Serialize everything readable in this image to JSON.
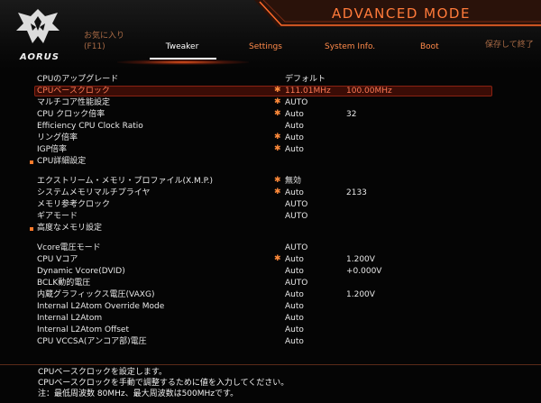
{
  "header": {
    "logo_text": "AORUS",
    "mode_title": "ADVANCED MODE"
  },
  "nav": {
    "favorites_label": "お気に入り",
    "favorites_key": "(F11)",
    "tweaker": "Tweaker",
    "settings": "Settings",
    "system_info": "System Info.",
    "boot": "Boot",
    "save_exit": "保存して終了"
  },
  "rows": [
    {
      "label": "CPUのアップグレード",
      "value": "デフォルト",
      "extra": "",
      "star": false,
      "selected": false,
      "bullet": false
    },
    {
      "label": "CPUベースクロック",
      "value": "111.01MHz",
      "extra": "100.00MHz",
      "star": true,
      "selected": true,
      "bullet": false
    },
    {
      "label": "マルチコア性能設定",
      "value": "AUTO",
      "extra": "",
      "star": true,
      "selected": false,
      "bullet": false
    },
    {
      "label": "CPU クロック倍率",
      "value": "Auto",
      "extra": "32",
      "star": true,
      "selected": false,
      "bullet": false
    },
    {
      "label": "Efficiency CPU Clock Ratio",
      "value": "Auto",
      "extra": "",
      "star": false,
      "selected": false,
      "bullet": false
    },
    {
      "label": "リング倍率",
      "value": "Auto",
      "extra": "",
      "star": true,
      "selected": false,
      "bullet": false
    },
    {
      "label": "IGP倍率",
      "value": "Auto",
      "extra": "",
      "star": true,
      "selected": false,
      "bullet": false
    },
    {
      "label": "CPU詳細設定",
      "value": "",
      "extra": "",
      "star": false,
      "selected": false,
      "bullet": true
    },
    {
      "label": "エクストリーム・メモリ・プロファイル(X.M.P.)",
      "value": "無効",
      "extra": "",
      "star": true,
      "selected": false,
      "bullet": false
    },
    {
      "label": "システムメモリマルチプライヤ",
      "value": "Auto",
      "extra": "2133",
      "star": true,
      "selected": false,
      "bullet": false
    },
    {
      "label": "メモリ参考クロック",
      "value": "AUTO",
      "extra": "",
      "star": false,
      "selected": false,
      "bullet": false
    },
    {
      "label": "ギアモード",
      "value": "AUTO",
      "extra": "",
      "star": false,
      "selected": false,
      "bullet": false
    },
    {
      "label": "高度なメモリ設定",
      "value": "",
      "extra": "",
      "star": false,
      "selected": false,
      "bullet": true
    },
    {
      "label": "Vcore電圧モード",
      "value": "AUTO",
      "extra": "",
      "star": false,
      "selected": false,
      "bullet": false
    },
    {
      "label": "CPU Vコア",
      "value": "Auto",
      "extra": "1.200V",
      "star": true,
      "selected": false,
      "bullet": false
    },
    {
      "label": "Dynamic Vcore(DVID)",
      "value": "Auto",
      "extra": "+0.000V",
      "star": false,
      "selected": false,
      "bullet": false
    },
    {
      "label": "BCLK動的電圧",
      "value": "AUTO",
      "extra": "",
      "star": false,
      "selected": false,
      "bullet": false
    },
    {
      "label": "内蔵グラフィックス電圧(VAXG)",
      "value": "Auto",
      "extra": "1.200V",
      "star": false,
      "selected": false,
      "bullet": false
    },
    {
      "label": "Internal L2Atom Override Mode",
      "value": "Auto",
      "extra": "",
      "star": false,
      "selected": false,
      "bullet": false
    },
    {
      "label": "Internal L2Atom",
      "value": "Auto",
      "extra": "",
      "star": false,
      "selected": false,
      "bullet": false
    },
    {
      "label": "Internal L2Atom Offset",
      "value": "Auto",
      "extra": "",
      "star": false,
      "selected": false,
      "bullet": false
    },
    {
      "label": "CPU VCCSA(アンコア部)電圧",
      "value": "Auto",
      "extra": "",
      "star": false,
      "selected": false,
      "bullet": false
    }
  ],
  "help": {
    "line1": "CPUベースクロックを設定します。",
    "line2": "CPUベースクロックを手動で調整するために値を入力してください。",
    "line3": "注：最低周波数 80MHz、最大周波数は500MHzです。"
  },
  "colors": {
    "accent": "#ff7a3a",
    "selected_bg": "#3a0c06"
  }
}
